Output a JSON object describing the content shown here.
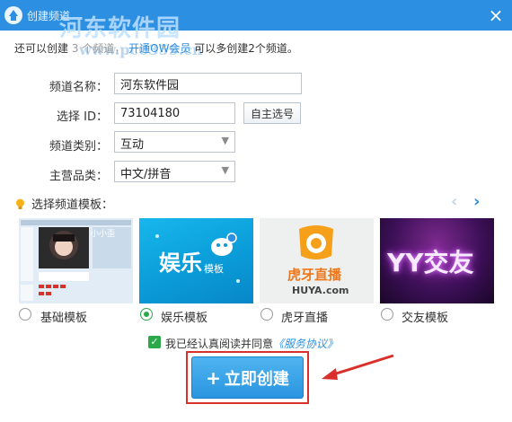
{
  "window": {
    "title": "创建频道",
    "watermark": {
      "name": "河东软件园",
      "url": "www.pc0359.cn"
    }
  },
  "notice": {
    "prefix": "还可以创建",
    "count": "3",
    "middle": "个频道，",
    "link": "开通OW会员",
    "suffix": "可以多创建2个频道。"
  },
  "form": {
    "name_label": "频道名称：",
    "name_value": "河东软件园",
    "id_label": "选择 ID：",
    "id_value": "73104180",
    "pick_button": "自主选号",
    "category_label": "频道类别：",
    "category_value": "互动",
    "lang_label": "主营品类：",
    "lang_value": "中文/拼音"
  },
  "templates": {
    "section_title": "选择频道模板：",
    "items": [
      {
        "label": "基础模板",
        "selected": false,
        "preview_text": "小小歪"
      },
      {
        "label": "娱乐模板",
        "selected": true,
        "preview_text": "娱乐",
        "preview_sub": "模板"
      },
      {
        "label": "虎牙直播",
        "selected": false,
        "preview_text": "虎牙直播",
        "preview_sub": "HUYA.com"
      },
      {
        "label": "交友模板",
        "selected": false,
        "preview_text": "YY交友"
      }
    ]
  },
  "agreement": {
    "checked": true,
    "text": "我已经认真阅读并同意",
    "link": "《服务协议》"
  },
  "create_button": {
    "icon": "+",
    "label": "立即创建"
  },
  "colors": {
    "accent": "#2d8fe1",
    "green": "#2aa84a",
    "highlight_red": "#d9302b"
  }
}
